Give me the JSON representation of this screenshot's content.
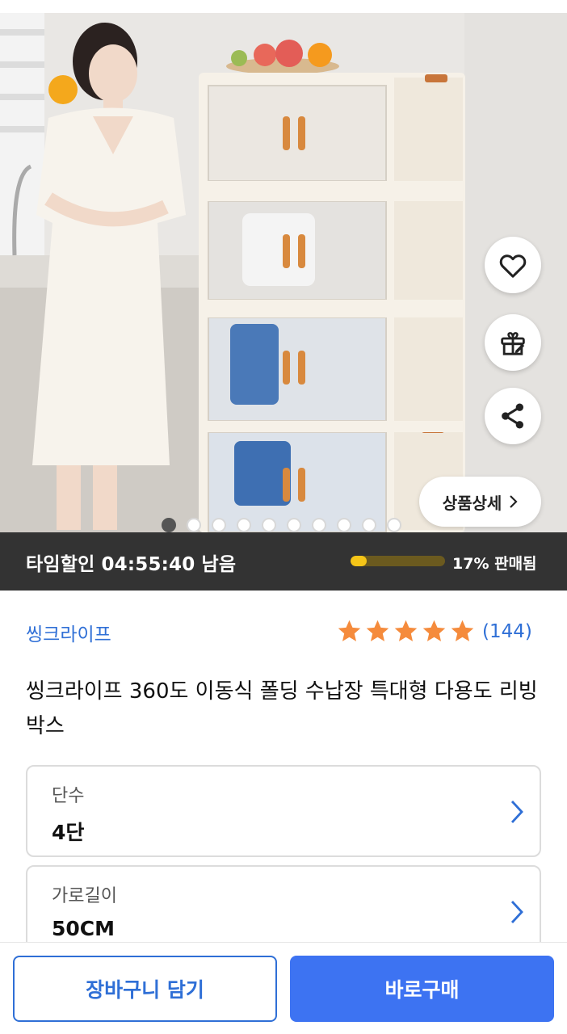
{
  "hero": {
    "image_alt": "product photo",
    "pager": {
      "total": 10,
      "current": 1
    },
    "detail_button_label": "상품상세",
    "actions": [
      "heart-icon",
      "gift-icon",
      "share-icon"
    ]
  },
  "timer": {
    "label": "타임할인",
    "time": "04:55:40",
    "suffix": "남음",
    "sold_label": "17% 판매됨",
    "sold_fraction": 0.17,
    "bar_color": "#f5c518"
  },
  "product": {
    "brand": "씽크라이프",
    "rating_count": "(144)",
    "stars": 5,
    "title": "씽크라이프 360도 이동식 폴딩 수납장 특대형 다용도 리빙박스"
  },
  "options": [
    {
      "label": "단수",
      "value": "4단"
    },
    {
      "label": "가로길이",
      "value": "50CM"
    }
  ],
  "bottom": {
    "cart_label": "장바구니 담기",
    "buy_label": "바로구매"
  },
  "colors": {
    "accent": "#3d73f2",
    "link": "#2f6fd6",
    "star": "#f58b3c",
    "timer_bg": "#333333"
  }
}
